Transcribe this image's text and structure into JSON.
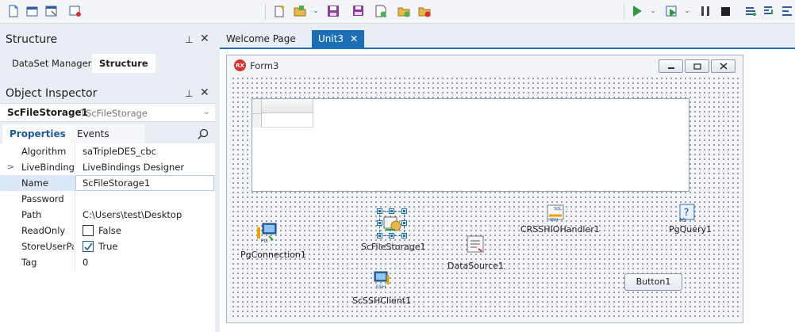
{
  "toolbar": {
    "left_icons": [
      "new-file-icon",
      "new-window-icon",
      "save-window-icon",
      "run-config-icon"
    ],
    "mid_icons": [
      "new-item-icon",
      "open-project-icon",
      "save-icon",
      "save-all-icon",
      "refresh-icon",
      "add-project-icon",
      "remove-project-icon"
    ],
    "right_icons": [
      "run-icon",
      "run-without-debug-icon",
      "pause-icon",
      "stop-icon",
      "step-over-icon",
      "trace-into-icon",
      "run-to-cursor-icon"
    ]
  },
  "structure": {
    "title": "Structure",
    "tabs": [
      "DataSet Manager",
      "Structure"
    ]
  },
  "object_inspector": {
    "title": "Object Inspector",
    "selected_name": "ScFileStorage1",
    "selected_type": "TScFileStorage",
    "tabs": [
      "Properties",
      "Events"
    ],
    "properties": [
      {
        "name": "Algorithm",
        "value": "saTripleDES_cbc"
      },
      {
        "name": "LiveBindings",
        "value": "LiveBindings Designer"
      },
      {
        "name": "Name",
        "value": "ScFileStorage1"
      },
      {
        "name": "Password",
        "value": ""
      },
      {
        "name": "Path",
        "value": "C:\\Users\\test\\Desktop"
      },
      {
        "name": "ReadOnly",
        "value": "False"
      },
      {
        "name": "StoreUserPas",
        "value": "True"
      },
      {
        "name": "Tag",
        "value": "0"
      }
    ]
  },
  "editor": {
    "tabs": [
      "Welcome Page",
      "Unit3"
    ]
  },
  "form": {
    "caption": "Form3",
    "icon_text": "RX",
    "components": {
      "pgconnection": "PgConnection1",
      "scfilestorage": "ScFileStorage1",
      "datasource": "DataSource1",
      "crsshiohandler": "CRSSHIOHandler1",
      "pgquery": "PgQuery1",
      "scsshclient": "ScSSHClient1",
      "button": "Button1"
    }
  },
  "colors": {
    "accent": "#1c6fb5",
    "panel_bg": "#e9edf4",
    "run_green": "#2e9b3c"
  }
}
